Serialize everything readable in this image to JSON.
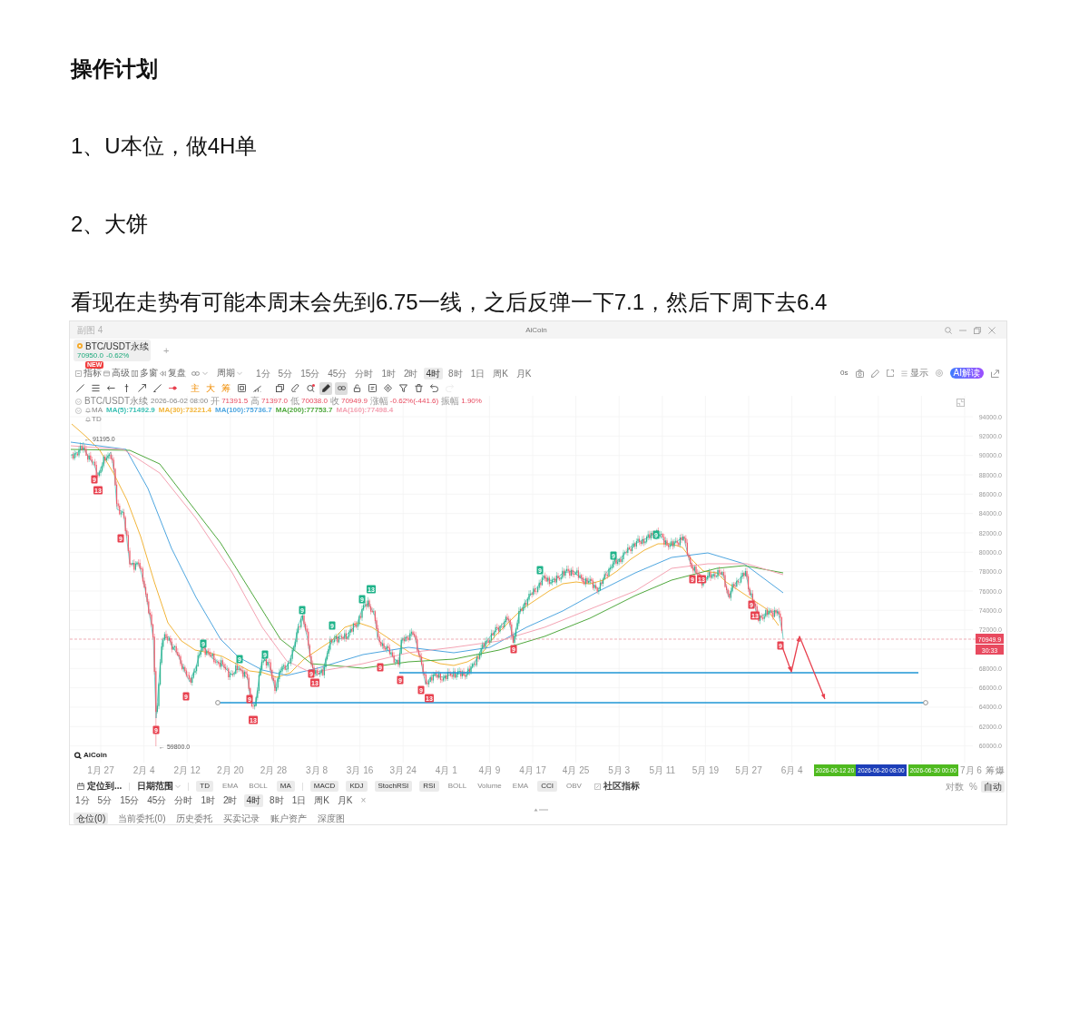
{
  "heading": "操作计划",
  "paragraphs": [
    "1、U本位，做4H单",
    "2、大饼",
    "看现在走势有可能本周末会先到6.75一线，之后反弹一下7.1，然后下周下去6.4"
  ],
  "app": {
    "title_bar": {
      "tab": "副图 4",
      "title": "AiCoin"
    },
    "symbol_tab": {
      "name": "BTC/USDT永续",
      "price": "70950.0",
      "change": "-0.62%",
      "add": "+"
    },
    "toolbar": {
      "tools": [
        {
          "label": "指标",
          "badge": "NEW"
        },
        {
          "label": "高级"
        },
        {
          "label": "多窗"
        },
        {
          "label": "复盘"
        }
      ],
      "period_menu": "周期",
      "periods": [
        {
          "label": "1分",
          "selected": false
        },
        {
          "label": "5分",
          "selected": false
        },
        {
          "label": "15分",
          "selected": false
        },
        {
          "label": "45分",
          "selected": false
        },
        {
          "label": "分时",
          "selected": false
        },
        {
          "label": "1时",
          "selected": false
        },
        {
          "label": "2时",
          "selected": false
        },
        {
          "label": "4时",
          "selected": true
        },
        {
          "label": "8时",
          "selected": false
        },
        {
          "label": "1日",
          "selected": false
        },
        {
          "label": "周K",
          "selected": false
        },
        {
          "label": "月K",
          "selected": false
        }
      ],
      "timer": "0s",
      "display": "显示",
      "ai_button": "AI解读"
    },
    "drawing_tools": [
      {
        "kind": "icon",
        "selected": false,
        "disabled": false
      },
      {
        "kind": "icon",
        "selected": false,
        "disabled": false
      },
      {
        "kind": "icon",
        "selected": false,
        "disabled": false
      },
      {
        "kind": "icon",
        "selected": false,
        "disabled": false
      },
      {
        "kind": "icon",
        "selected": false,
        "disabled": false
      },
      {
        "kind": "icon",
        "selected": false,
        "disabled": false
      },
      {
        "kind": "icon",
        "selected": false,
        "disabled": false
      },
      {
        "kind": "char",
        "label": "主",
        "selected": false,
        "disabled": false
      },
      {
        "kind": "char",
        "label": "大",
        "selected": false,
        "disabled": false
      },
      {
        "kind": "char",
        "label": "筹",
        "selected": false,
        "disabled": false
      },
      {
        "kind": "icon",
        "selected": false,
        "disabled": false
      },
      {
        "kind": "icon",
        "selected": false,
        "disabled": false
      },
      {
        "kind": "icon",
        "selected": false,
        "disabled": false
      },
      {
        "kind": "icon",
        "selected": false,
        "disabled": false
      },
      {
        "kind": "icon",
        "selected": false,
        "disabled": false
      },
      {
        "kind": "icon",
        "selected": true,
        "disabled": false
      },
      {
        "kind": "icon",
        "selected": true,
        "disabled": false
      },
      {
        "kind": "icon",
        "selected": false,
        "disabled": false
      },
      {
        "kind": "icon",
        "selected": false,
        "disabled": false
      },
      {
        "kind": "icon",
        "selected": false,
        "disabled": false
      },
      {
        "kind": "icon",
        "selected": false,
        "disabled": false
      },
      {
        "kind": "icon",
        "selected": false,
        "disabled": false
      },
      {
        "kind": "icon",
        "selected": false,
        "disabled": false
      },
      {
        "kind": "icon",
        "selected": false,
        "disabled": true
      }
    ],
    "chart": {
      "info": {
        "symbol": "BTC/USDT永续",
        "time": "2026-06-02 08:00",
        "fields": [
          {
            "label": "开",
            "value": "71391.5"
          },
          {
            "label": "高",
            "value": "71397.0"
          },
          {
            "label": "低",
            "value": "70038.0"
          },
          {
            "label": "收",
            "value": "70949.9"
          },
          {
            "label": "涨幅",
            "value": "-0.62%(-441.6)"
          },
          {
            "label": "振幅",
            "value": "1.90%"
          }
        ]
      },
      "ma": {
        "label": "MA",
        "lines": [
          {
            "label": "MA(5):71492.9",
            "color": "#3cc0b4"
          },
          {
            "label": "MA(30):73221.4",
            "color": "#f2b53a"
          },
          {
            "label": "MA(100):75736.7",
            "color": "#4ea6e0"
          },
          {
            "label": "MA(200):77753.7",
            "color": "#4fa83d"
          },
          {
            "label": "MA(160):77498.4",
            "color": "#f4a3b3"
          }
        ]
      },
      "td_label": "TD",
      "high_label": "← 91195.0",
      "low_label": "← 59800.0",
      "y_labels": [
        "94000.0",
        "92000.0",
        "90000.0",
        "88000.0",
        "86000.0",
        "84000.0",
        "82000.0",
        "80000.0",
        "78000.0",
        "76000.0",
        "74000.0",
        "72000.0",
        "68000.0",
        "66000.0",
        "64000.0",
        "62000.0",
        "60000.0"
      ],
      "price_tag": "70949.9",
      "countdown": "30:33",
      "td_markers": [
        {
          "label": "9",
          "color": "#e8414f"
        },
        {
          "label": "13",
          "color": "#e8414f"
        },
        {
          "label": "9",
          "color": "#e8414f"
        },
        {
          "label": "9",
          "color": "#e8414f"
        },
        {
          "label": "9",
          "color": "#e8414f"
        },
        {
          "label": "9",
          "color": "#1fb38a"
        },
        {
          "label": "9",
          "color": "#1fb38a"
        },
        {
          "label": "9",
          "color": "#e8414f"
        },
        {
          "label": "13",
          "color": "#e8414f"
        },
        {
          "label": "9",
          "color": "#1fb38a"
        },
        {
          "label": "9",
          "color": "#1fb38a"
        },
        {
          "label": "9",
          "color": "#e8414f"
        },
        {
          "label": "13",
          "color": "#e8414f"
        },
        {
          "label": "9",
          "color": "#1fb38a"
        },
        {
          "label": "9",
          "color": "#1fb38a"
        },
        {
          "label": "13",
          "color": "#1fb38a"
        },
        {
          "label": "9",
          "color": "#e8414f"
        },
        {
          "label": "9",
          "color": "#e8414f"
        },
        {
          "label": "9",
          "color": "#e8414f"
        },
        {
          "label": "13",
          "color": "#e8414f"
        },
        {
          "label": "9",
          "color": "#e8414f"
        },
        {
          "label": "9",
          "color": "#1fb38a"
        },
        {
          "label": "9",
          "color": "#1fb38a"
        },
        {
          "label": "9",
          "color": "#1fb38a"
        },
        {
          "label": "9",
          "color": "#e8414f"
        },
        {
          "label": "13",
          "color": "#e8414f"
        },
        {
          "label": "9",
          "color": "#e8414f"
        },
        {
          "label": "13",
          "color": "#e8414f"
        },
        {
          "label": "9",
          "color": "#e8414f"
        }
      ],
      "logo": "AiCoin"
    },
    "x_axis": {
      "labels": [
        "1月 27",
        "2月 4",
        "2月 12",
        "2月 20",
        "2月 28",
        "3月 8",
        "3月 16",
        "3月 24",
        "4月 1",
        "4月 9",
        "4月 17",
        "4月 25",
        "5月 3",
        "5月 11",
        "5月 19",
        "5月 27",
        "6月 4"
      ],
      "time_tags": [
        {
          "label": "2026-06-12 20",
          "color": "#4fba1f"
        },
        {
          "label": "2026-06-20 08:00",
          "color": "#1d3fb8"
        },
        {
          "label": "2026-06-30 00:00",
          "color": "#4fba1f"
        }
      ],
      "tail_label": "7月 6",
      "side": [
        "筹",
        "爆"
      ]
    },
    "indicator_bar": {
      "locate": "定位到...",
      "date_range": "日期范围",
      "main": [
        {
          "label": "TD",
          "selected": true
        },
        {
          "label": "EMA",
          "selected": false
        },
        {
          "label": "BOLL",
          "selected": false
        },
        {
          "label": "MA",
          "selected": true
        }
      ],
      "sub": [
        {
          "label": "MACD",
          "selected": true
        },
        {
          "label": "KDJ",
          "selected": true
        },
        {
          "label": "StochRSI",
          "selected": true
        },
        {
          "label": "RSI",
          "selected": true
        },
        {
          "label": "BOLL",
          "selected": false
        },
        {
          "label": "Volume",
          "selected": false
        },
        {
          "label": "EMA",
          "selected": false
        },
        {
          "label": "CCI",
          "selected": true
        },
        {
          "label": "OBV",
          "selected": false
        }
      ],
      "community": "社区指标",
      "scale": [
        {
          "label": "对数",
          "selected": false
        },
        {
          "label": "%",
          "selected": false
        },
        {
          "label": "自动",
          "selected": true
        }
      ]
    },
    "period_bar": {
      "periods": [
        {
          "label": "1分",
          "selected": false
        },
        {
          "label": "5分",
          "selected": false
        },
        {
          "label": "15分",
          "selected": false
        },
        {
          "label": "45分",
          "selected": false
        },
        {
          "label": "分时",
          "selected": false
        },
        {
          "label": "1时",
          "selected": false
        },
        {
          "label": "2时",
          "selected": false
        },
        {
          "label": "4时",
          "selected": true
        },
        {
          "label": "8时",
          "selected": false
        },
        {
          "label": "1日",
          "selected": false
        },
        {
          "label": "周K",
          "selected": false
        },
        {
          "label": "月K",
          "selected": false
        }
      ],
      "close": "×"
    },
    "order_tabs": [
      {
        "label": "仓位(0)",
        "selected": true
      },
      {
        "label": "当前委托(0)",
        "selected": false
      },
      {
        "label": "历史委托",
        "selected": false
      },
      {
        "label": "买卖记录",
        "selected": false
      },
      {
        "label": "账户资产",
        "selected": false
      },
      {
        "label": "深度图",
        "selected": false
      }
    ]
  }
}
